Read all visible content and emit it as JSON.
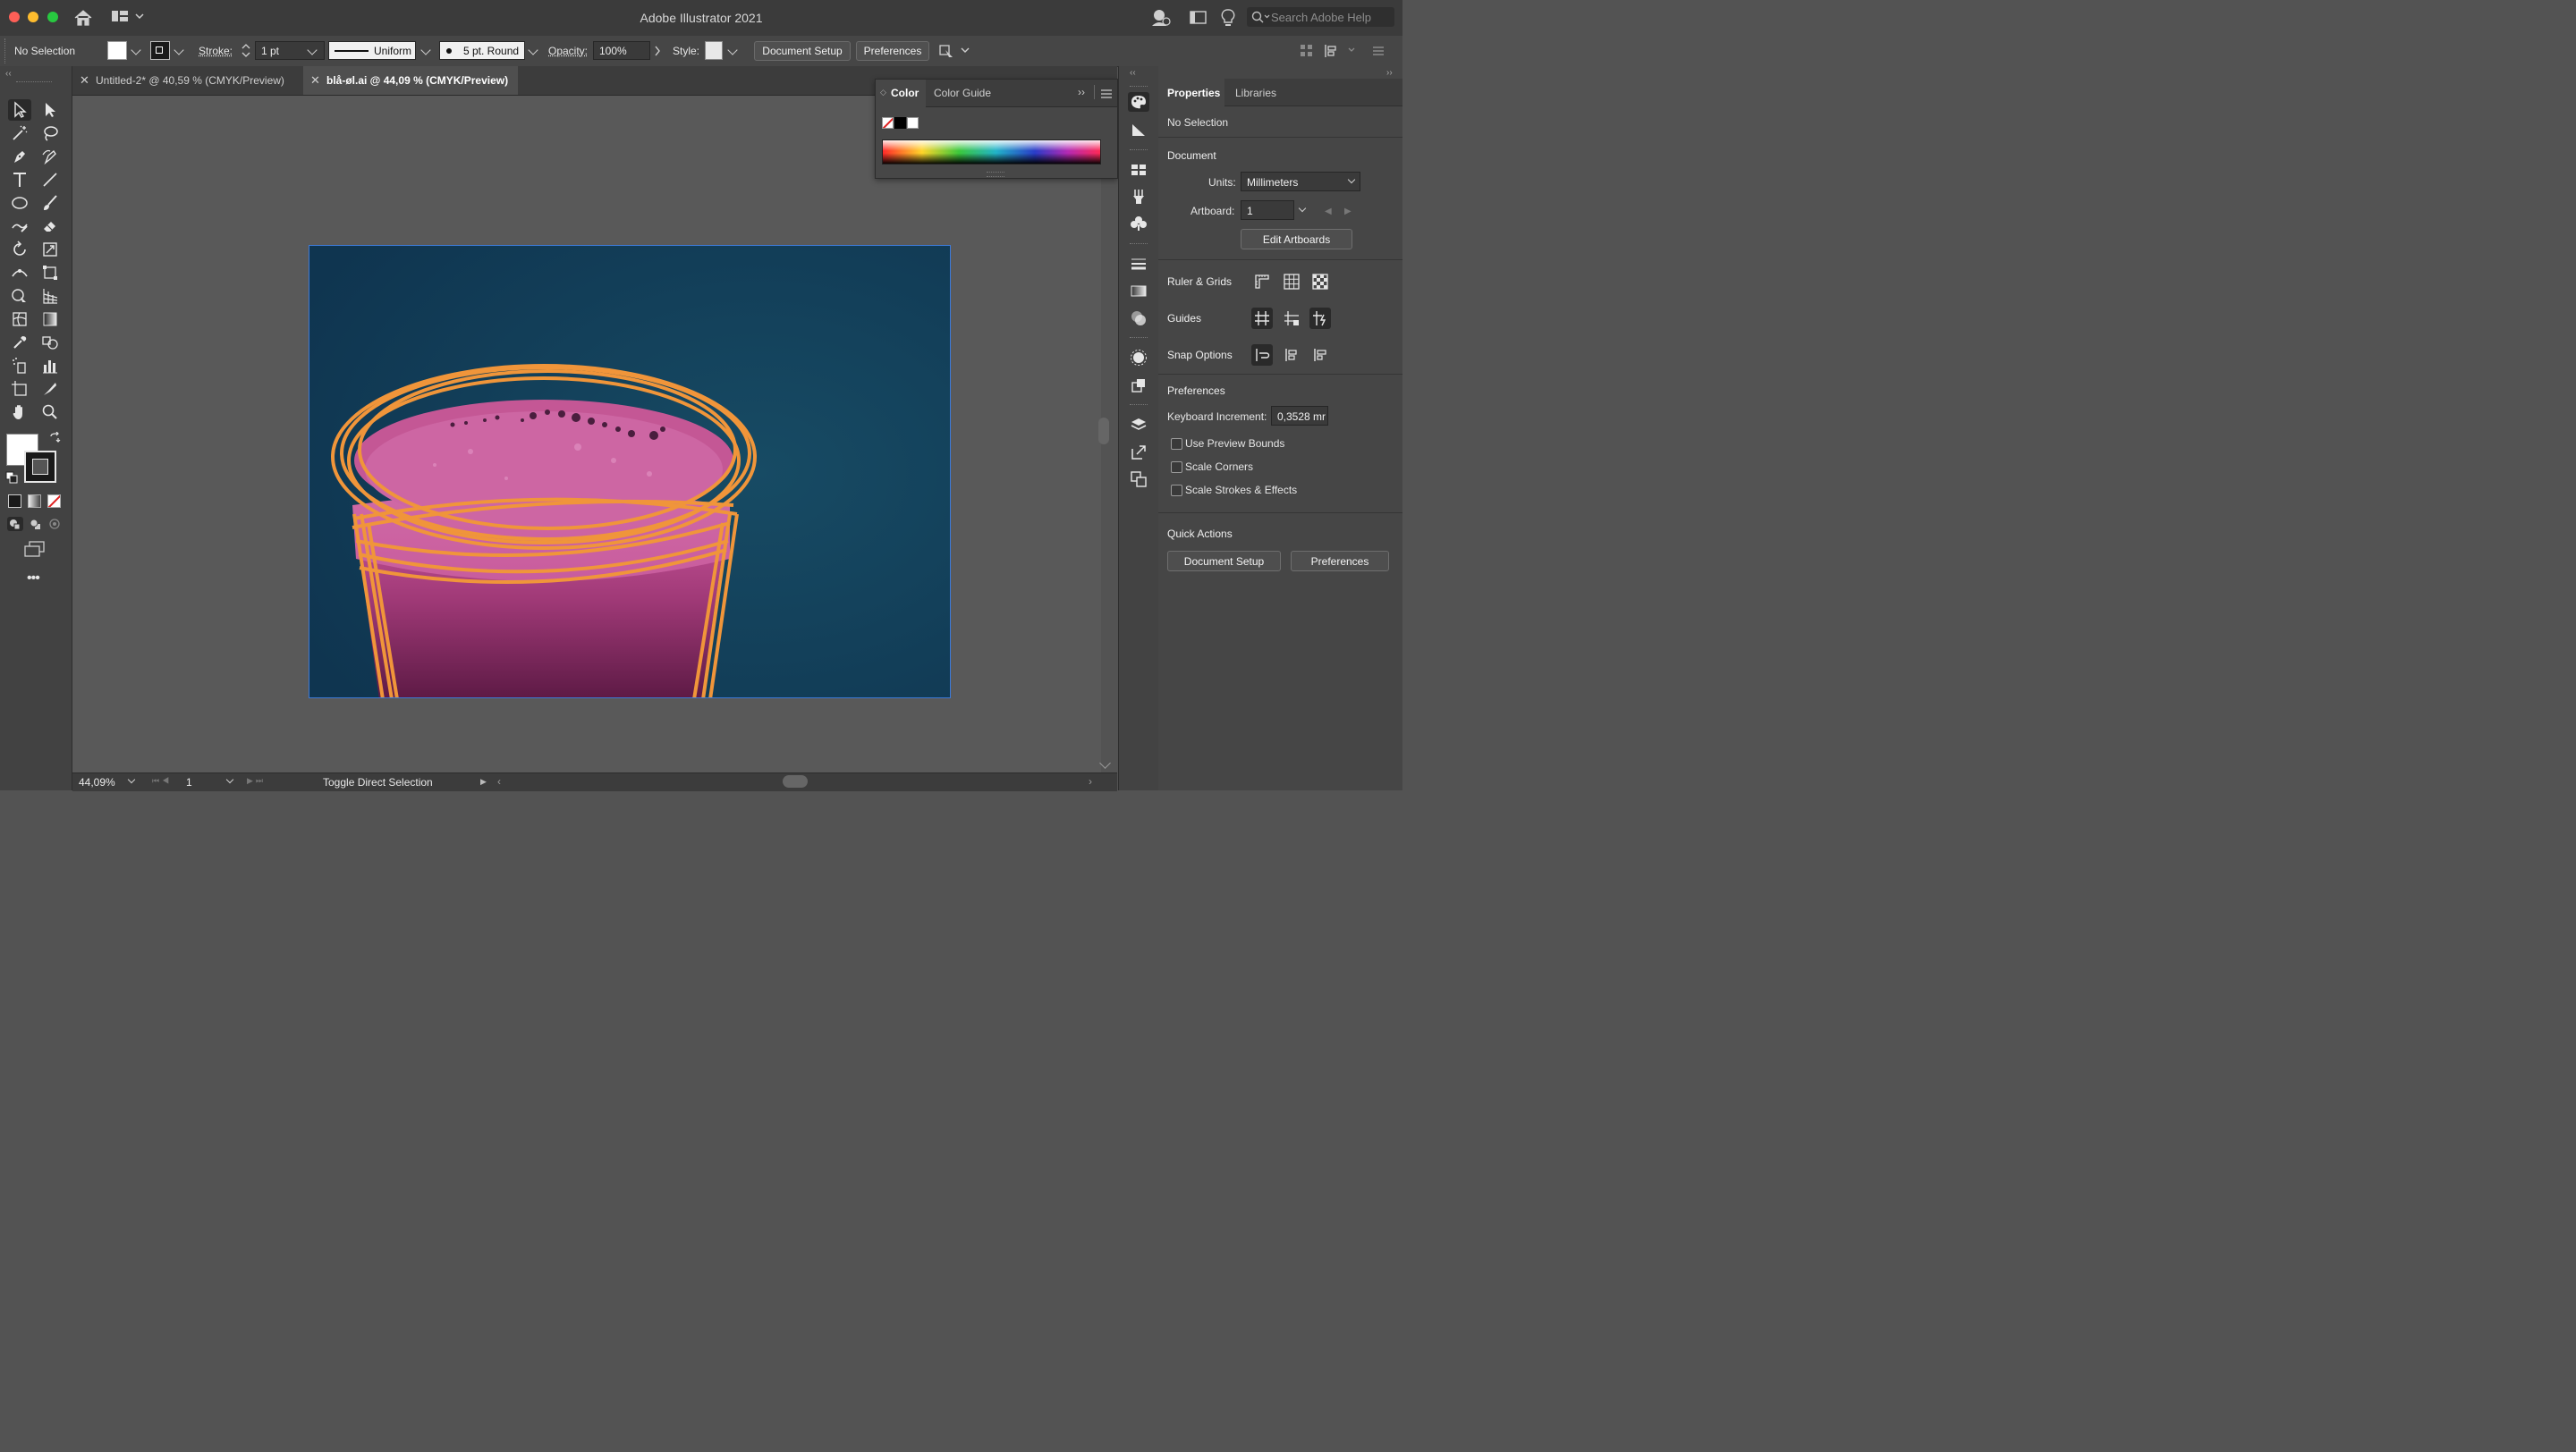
{
  "window": {
    "title": "Adobe Illustrator 2021",
    "search_placeholder": "Search Adobe Help"
  },
  "control_bar": {
    "selection": "No Selection",
    "stroke_label": "Stroke:",
    "stroke_weight": "1 pt",
    "profile": "Uniform",
    "brush": "5 pt. Round",
    "opacity_label": "Opacity:",
    "opacity_value": "100%",
    "style_label": "Style:",
    "document_setup": "Document Setup",
    "preferences": "Preferences"
  },
  "tabs": [
    {
      "label": "Untitled-2* @ 40,59 % (CMYK/Preview)",
      "active": false
    },
    {
      "label": "blå-øl.ai @ 44,09 % (CMYK/Preview)",
      "active": true
    }
  ],
  "color_panel": {
    "tab_color": "Color",
    "tab_guide": "Color Guide"
  },
  "properties": {
    "tab_properties": "Properties",
    "tab_libraries": "Libraries",
    "no_selection": "No Selection",
    "document": "Document",
    "units_label": "Units:",
    "units_value": "Millimeters",
    "artboard_label": "Artboard:",
    "artboard_value": "1",
    "edit_artboards": "Edit Artboards",
    "ruler_grids": "Ruler & Grids",
    "guides": "Guides",
    "snap_options": "Snap Options",
    "preferences": "Preferences",
    "keyboard_increment_label": "Keyboard Increment:",
    "keyboard_increment_value": "0,3528 mr",
    "use_preview_bounds": "Use Preview Bounds",
    "scale_corners": "Scale Corners",
    "scale_strokes": "Scale Strokes & Effects",
    "quick_actions": "Quick Actions",
    "qa_document_setup": "Document Setup",
    "qa_preferences": "Preferences"
  },
  "status_bar": {
    "zoom": "44,09%",
    "artboard": "1",
    "status_text": "Toggle Direct Selection"
  },
  "colors": {
    "artwork_bg": "#12405a",
    "beer_magenta": "#c0508f",
    "outline_orange": "#f0953a",
    "selection_blue": "#3d7ad6"
  }
}
